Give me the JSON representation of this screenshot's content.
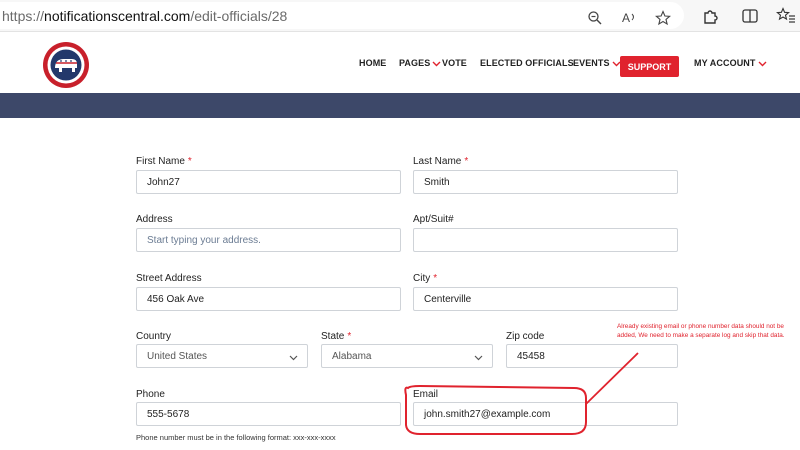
{
  "browser": {
    "url_prefix": "https://",
    "url_domain": "notificationscentral.com",
    "url_path": "/edit-officials/28",
    "icons": [
      "zoom-icon",
      "read-aloud-icon",
      "favorite-star-icon",
      "extensions-icon",
      "split-screen-icon",
      "favorites-icon"
    ]
  },
  "site": {
    "logo_text_top": "REPUBLICAN",
    "logo_text_bottom": "ADVOCATES",
    "nav": {
      "home": "HOME",
      "pages": "PAGES",
      "vote": "VOTE",
      "elected_officials": "ELECTED OFFICIALS",
      "events": "EVENTS",
      "support": "SUPPORT",
      "my_account": "MY ACCOUNT"
    },
    "colors": {
      "accent": "#e0232e",
      "banner": "#3d4869"
    }
  },
  "form": {
    "first_name": {
      "label": "First Name",
      "value": "John27",
      "required": "*"
    },
    "last_name": {
      "label": "Last Name",
      "value": "Smith",
      "required": "*"
    },
    "address": {
      "label": "Address",
      "placeholder": "Start typing your address."
    },
    "apt_suit": {
      "label": "Apt/Suit#",
      "value": ""
    },
    "street_address": {
      "label": "Street Address",
      "value": "456 Oak Ave"
    },
    "city": {
      "label": "City",
      "value": "Centerville",
      "required": "*"
    },
    "country": {
      "label": "Country",
      "value": "United States"
    },
    "state": {
      "label": "State",
      "value": "Alabama",
      "required": "*"
    },
    "zip_code": {
      "label": "Zip code",
      "value": "45458"
    },
    "phone": {
      "label": "Phone",
      "value": "555-5678",
      "hint": "Phone number must be in the following format: xxx-xxx-xxxx"
    },
    "email": {
      "label": "Email",
      "value": "john.smith27@example.com"
    }
  },
  "annotation": {
    "text": "Already existing email or phone number data should not be added, We need to make a separate log and skip that data."
  }
}
